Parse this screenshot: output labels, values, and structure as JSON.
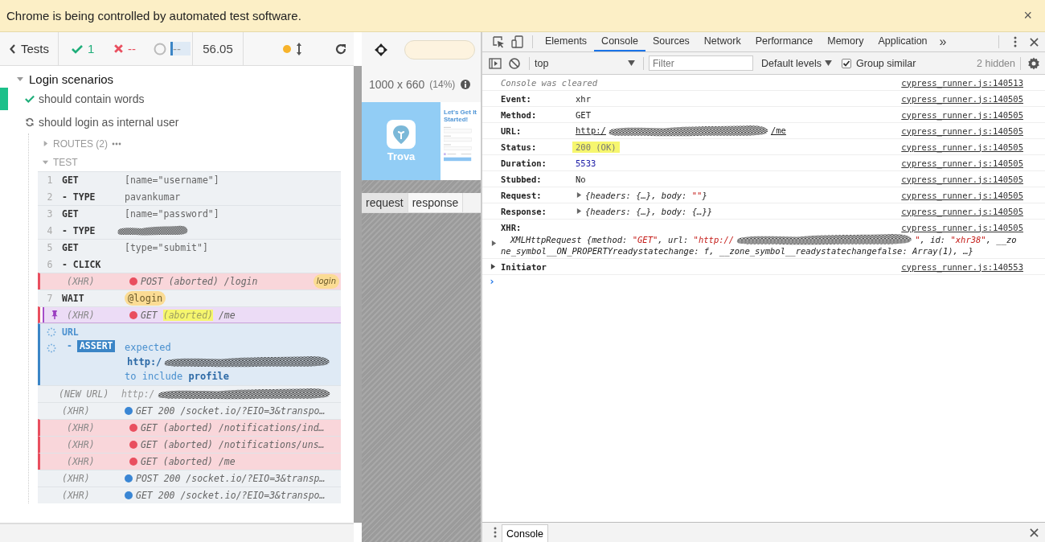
{
  "infobar": {
    "message": "Chrome is being controlled by automated test software.",
    "close": "×"
  },
  "reporter": {
    "back": "Tests",
    "passed": "1",
    "failed": "--",
    "pending": "--",
    "duration": "56.05",
    "suite": {
      "title": "Login scenarios",
      "expanded": true,
      "tests": [
        {
          "title": "should contain words",
          "kind": "passed"
        },
        {
          "title": "should login as internal user",
          "kind": "running",
          "hooks": [
            {
              "label": "ROUTES (2)",
              "expanded": false
            },
            {
              "label": "TEST",
              "expanded": true
            }
          ],
          "commands": [
            {
              "kind": "command",
              "number": "1",
              "name": "GET",
              "message": "[name=\"username\"]"
            },
            {
              "kind": "child",
              "number": "2",
              "name": "- TYPE",
              "message": "pavankumar"
            },
            {
              "kind": "command",
              "number": "3",
              "name": "GET",
              "message": "[name=\"password\"]"
            },
            {
              "kind": "child",
              "number": "4",
              "name": "- TYPE",
              "redacted": true
            },
            {
              "kind": "command",
              "number": "5",
              "name": "GET",
              "message": "[type=\"submit\"]"
            },
            {
              "kind": "child",
              "number": "6",
              "name": "- CLICK"
            },
            {
              "kind": "xhr",
              "name": "(XHR)",
              "failed": true,
              "method": "POST",
              "result": "(aborted)",
              "path": "/login",
              "highlight": false,
              "pinned": false,
              "alias": "login"
            },
            {
              "kind": "wait",
              "number": "7",
              "name": "WAIT",
              "alias": "@login"
            },
            {
              "kind": "xhr",
              "name": "(XHR)",
              "failed": true,
              "method": "GET",
              "result": "(aborted)",
              "path": "/me",
              "highlight": true,
              "pinned": true
            },
            {
              "kind": "pending",
              "name": "URL"
            },
            {
              "kind": "assert",
              "prefix": "-",
              "name": "ASSERT",
              "expected": "expected",
              "value": "http:/",
              "redacted": true,
              "phrase": "to include **profile**"
            },
            {
              "kind": "event",
              "name": "(NEW URL)",
              "message": "http:/",
              "redacted": true
            },
            {
              "kind": "xhr",
              "name": "(XHR)",
              "failed": false,
              "method": "GET",
              "result": "200",
              "path": "/socket.io/?EIO=3&transpo…",
              "highlight": false,
              "pinned": false
            },
            {
              "kind": "xhr",
              "name": "(XHR)",
              "failed": true,
              "method": "GET",
              "result": "(aborted)",
              "path": "/notifications/ind…",
              "highlight": false,
              "pinned": false
            },
            {
              "kind": "xhr",
              "name": "(XHR)",
              "failed": true,
              "method": "GET",
              "result": "(aborted)",
              "path": "/notifications/uns…",
              "highlight": false,
              "pinned": false
            },
            {
              "kind": "xhr",
              "name": "(XHR)",
              "failed": true,
              "method": "GET",
              "result": "(aborted)",
              "path": "/me",
              "highlight": false,
              "pinned": false
            },
            {
              "kind": "xhr",
              "name": "(XHR)",
              "failed": false,
              "method": "POST",
              "result": "200",
              "path": "/socket.io/?EIO=3&transp…",
              "highlight": false,
              "pinned": false
            },
            {
              "kind": "xhr",
              "name": "(XHR)",
              "failed": false,
              "method": "GET",
              "result": "200",
              "path": "/socket.io/?EIO=3&transpo…",
              "highlight": false,
              "pinned": false
            }
          ]
        }
      ]
    }
  },
  "preview": {
    "size": "1000 x 660",
    "scale": "(14%)",
    "app_name": "Trova",
    "heading": "Let's Get It Started!",
    "tabs": [
      {
        "label": "request",
        "selected": true
      },
      {
        "label": "response",
        "selected": false
      }
    ]
  },
  "devtools": {
    "tabs": [
      {
        "label": "Elements",
        "selected": false
      },
      {
        "label": "Console",
        "selected": true
      },
      {
        "label": "Sources",
        "selected": false
      },
      {
        "label": "Network",
        "selected": false
      },
      {
        "label": "Performance",
        "selected": false
      },
      {
        "label": "Memory",
        "selected": false
      },
      {
        "label": "Application",
        "selected": false
      }
    ],
    "more": "»",
    "context": "top",
    "filter_placeholder": "Filter",
    "levels": "Default levels",
    "group_similar": {
      "label": "Group similar",
      "checked": true
    },
    "hidden": "2 hidden",
    "entries": [
      {
        "kind": "note",
        "text": "Console was cleared",
        "source": "cypress_runner.js:140513"
      },
      {
        "kind": "field",
        "label": "Event:",
        "expandable": false,
        "parts": [
          {
            "kind": "text",
            "text": "xhr"
          }
        ],
        "source": "cypress_runner.js:140505"
      },
      {
        "kind": "field",
        "label": "Method:",
        "expandable": false,
        "parts": [
          {
            "kind": "text",
            "text": "GET"
          }
        ],
        "source": "cypress_runner.js:140505"
      },
      {
        "kind": "field",
        "label": "URL:",
        "expandable": false,
        "parts": [
          {
            "kind": "link",
            "text": "http:/"
          },
          {
            "kind": "redacted"
          },
          {
            "kind": "link",
            "text": "/me"
          }
        ],
        "source": "cypress_runner.js:140505"
      },
      {
        "kind": "field",
        "label": "Status:",
        "expandable": false,
        "parts": [
          {
            "kind": "highlight",
            "text": "200 (OK)"
          }
        ],
        "source": "cypress_runner.js:140505"
      },
      {
        "kind": "field",
        "label": "Duration:",
        "expandable": false,
        "parts": [
          {
            "kind": "number",
            "text": "5533"
          }
        ],
        "source": "cypress_runner.js:140505"
      },
      {
        "kind": "field",
        "label": "Stubbed:",
        "expandable": false,
        "parts": [
          {
            "kind": "text",
            "text": "No"
          }
        ],
        "source": "cypress_runner.js:140505"
      },
      {
        "kind": "field",
        "label": "Request:",
        "expandable": true,
        "parts": [
          {
            "kind": "text",
            "text": "{headers: {…}, body: "
          },
          {
            "kind": "string",
            "text": "\"\""
          },
          {
            "kind": "text",
            "text": "}"
          }
        ],
        "source": "cypress_runner.js:140505"
      },
      {
        "kind": "field",
        "label": "Response:",
        "expandable": true,
        "parts": [
          {
            "kind": "text",
            "text": "{headers: {…}, body: {…}}"
          }
        ],
        "source": "cypress_runner.js:140505"
      },
      {
        "kind": "object",
        "label": "XHR:",
        "lines": [
          [
            {
              "kind": "text",
              "text": "XMLHttpRequest {method: "
            },
            {
              "kind": "string",
              "text": "\"GET\""
            },
            {
              "kind": "text",
              "text": ", url: "
            },
            {
              "kind": "string",
              "text": "\"http://"
            },
            {
              "kind": "redacted"
            },
            {
              "kind": "string",
              "text": "\""
            },
            {
              "kind": "text",
              "text": ", id: "
            },
            {
              "kind": "string",
              "text": "\"xhr38\""
            },
            {
              "kind": "text",
              "text": ", __zo"
            }
          ],
          [
            {
              "kind": "text",
              "text": "ne_symbol__ON_PROPERTYreadystatechange: f, __zone_symbol__readystatechangefalse: Array(1), …}"
            }
          ]
        ],
        "source": "cypress_runner.js:140505"
      },
      {
        "kind": "group",
        "label": "Initiator",
        "expanded": false,
        "source": "cypress_runner.js:140553"
      }
    ],
    "prompt": "›",
    "drawer_tab": "Console"
  }
}
